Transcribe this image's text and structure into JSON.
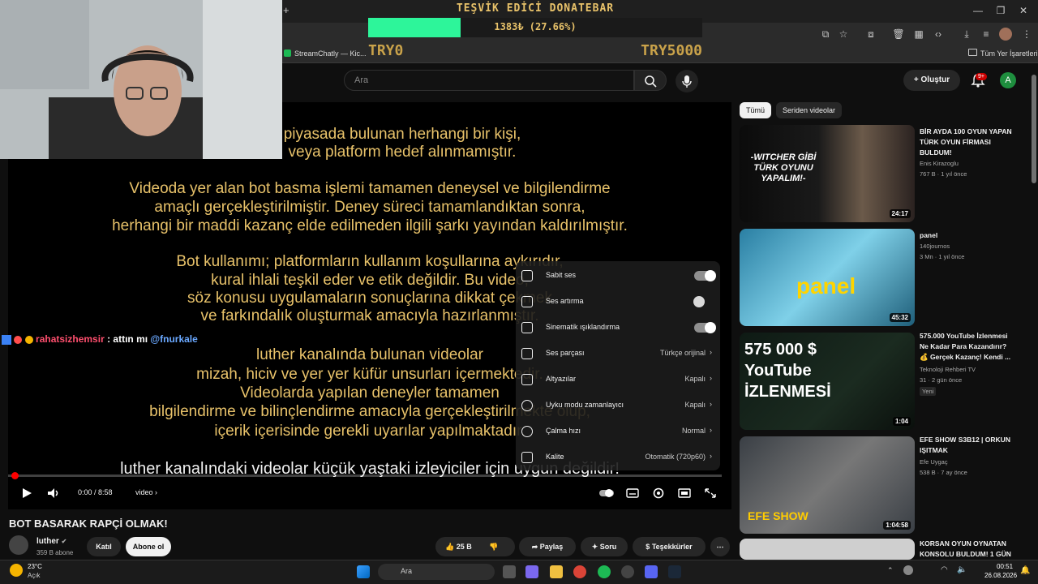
{
  "browser": {
    "new_tab": "+",
    "tab_title": "StreamChatly — Kic...",
    "bookmarks_all": "Tüm Yer İşaretleri",
    "win_controls": [
      "—",
      "❐",
      "✕"
    ]
  },
  "donate_bar": {
    "title": "TEŞVİK EDİCİ DONATEBAR",
    "amount": "1383₺ (27.66%)",
    "progress_fraction": 0.2766,
    "min": "TRY0",
    "max": "TRY5000",
    "fill_color": "#2df59a"
  },
  "header": {
    "search_placeholder": "Ara",
    "create_label": "Oluştur",
    "notif_badge": "9+",
    "avatar_letter": "A"
  },
  "subtitles": {
    "gold_lines_1": [
      "piyasada bulunan herhangi bir kişi,",
      "veya platform hedef alınmamıştır."
    ],
    "gold_block_2": [
      "Videoda yer alan bot basma işlemi tamamen deneysel ve bilgilendirme",
      "amaçlı gerçekleştirilmiştir. Deney süreci tamamlandıktan sonra,",
      "herhangi bir maddi kazanç elde edilmeden ilgili şarkı yayından kaldırılmıştır."
    ],
    "gold_block_3": [
      "Bot kullanımı; platformların kullanım koşullarına aykırıdır,",
      "kural ihlali teşkil eder ve etik değildir. Bu video,",
      "söz konusu uygulamaların sonuçlarına dikkat çekmek",
      "ve farkındalık oluşturmak amacıyla hazırlanmıştır."
    ],
    "gold_block_4": [
      "luther kanalında bulunan videolar",
      "mizah, hiciv ve yer yer küfür unsurları içermektedir.",
      "Videolarda yapılan deneyler tamamen",
      "bilgilendirme ve bilinçlendirme amacıyla gerçekleştirilmekte olup,",
      "içerik içerisinde gerekli uyarılar yapılmaktadır."
    ],
    "white_caption": "luther kanalındaki videolar küçük yaştaki izleyiciler için uygun değildir!"
  },
  "chat": {
    "user": "rahatsizhemsir",
    "message": ": attın mı",
    "mention": "@fnurkale"
  },
  "player": {
    "time": "0:00 / 8:58",
    "chapter": "video",
    "progress_fraction": 0.0
  },
  "settings_menu": [
    {
      "label": "Sabit ses",
      "type": "toggle",
      "on": true
    },
    {
      "label": "Ses artırma",
      "type": "toggle",
      "on": false
    },
    {
      "label": "Sinematik ışıklandırma",
      "type": "toggle",
      "on": true
    },
    {
      "label": "Ses parçası",
      "value": "Türkçe orijinal"
    },
    {
      "label": "Altyazılar",
      "value": "Kapalı"
    },
    {
      "label": "Uyku modu zamanlayıcı",
      "value": "Kapalı"
    },
    {
      "label": "Çalma hızı",
      "value": "Normal"
    },
    {
      "label": "Kalite",
      "value": "Otomatik (720p60)"
    }
  ],
  "video": {
    "title": "BOT BASARAK RAPÇİ OLMAK!",
    "channel": "luther",
    "subs": "359 B abone",
    "join_label": "Katıl",
    "subscribe_label": "Abone ol",
    "likes": "25 B",
    "share_label": "Paylaş",
    "ask_label": "Soru",
    "thanks_label": "Teşekkürler"
  },
  "sidebar": {
    "chips": [
      "Tümü",
      "Seriden videolar"
    ],
    "recs": [
      {
        "title": "BİR AYDA 100 OYUN YAPAN TÜRK OYUN FİRMASI BULDUM!",
        "channel": "Enis Kirazoglu",
        "meta": "767 B · 1 yıl önce",
        "duration": "24:17",
        "thumb_text": "-WITCHER GİBİ TÜRK OYUNU YAPALIM!-"
      },
      {
        "title": "panel",
        "channel": "140journos",
        "meta": "3 Mn · 1 yıl önce",
        "duration": "45:32",
        "thumb_text": "panel"
      },
      {
        "title": "575.000 YouTube İzlenmesi Ne Kadar Para Kazandırır? 💰 Gerçek Kazanç! Kendi ...",
        "channel": "Teknoloji Rehberi TV",
        "meta": "31 · 2 gün önce",
        "badge": "Yeni",
        "duration": "1:04",
        "thumb_text": "575 000 $ YouTube İZLENMESİ"
      },
      {
        "title": "EFE SHOW S3B12 | ORKUN IŞITMAK",
        "channel": "Efe Uygaç",
        "meta": "538 B · 7 ay önce",
        "duration": "1:04:58",
        "thumb_text": "EFE SHOW"
      },
      {
        "title": "KORSAN OYUN OYNATAN KONSOLU BULDUM! 1 GÜN",
        "channel": "",
        "meta": "",
        "duration": "",
        "thumb_text": ""
      }
    ]
  },
  "taskbar": {
    "weather_temp": "23°C",
    "weather_desc": "Açık",
    "search_label": "Ara",
    "time": "00:51",
    "date": "26.08.2026"
  }
}
